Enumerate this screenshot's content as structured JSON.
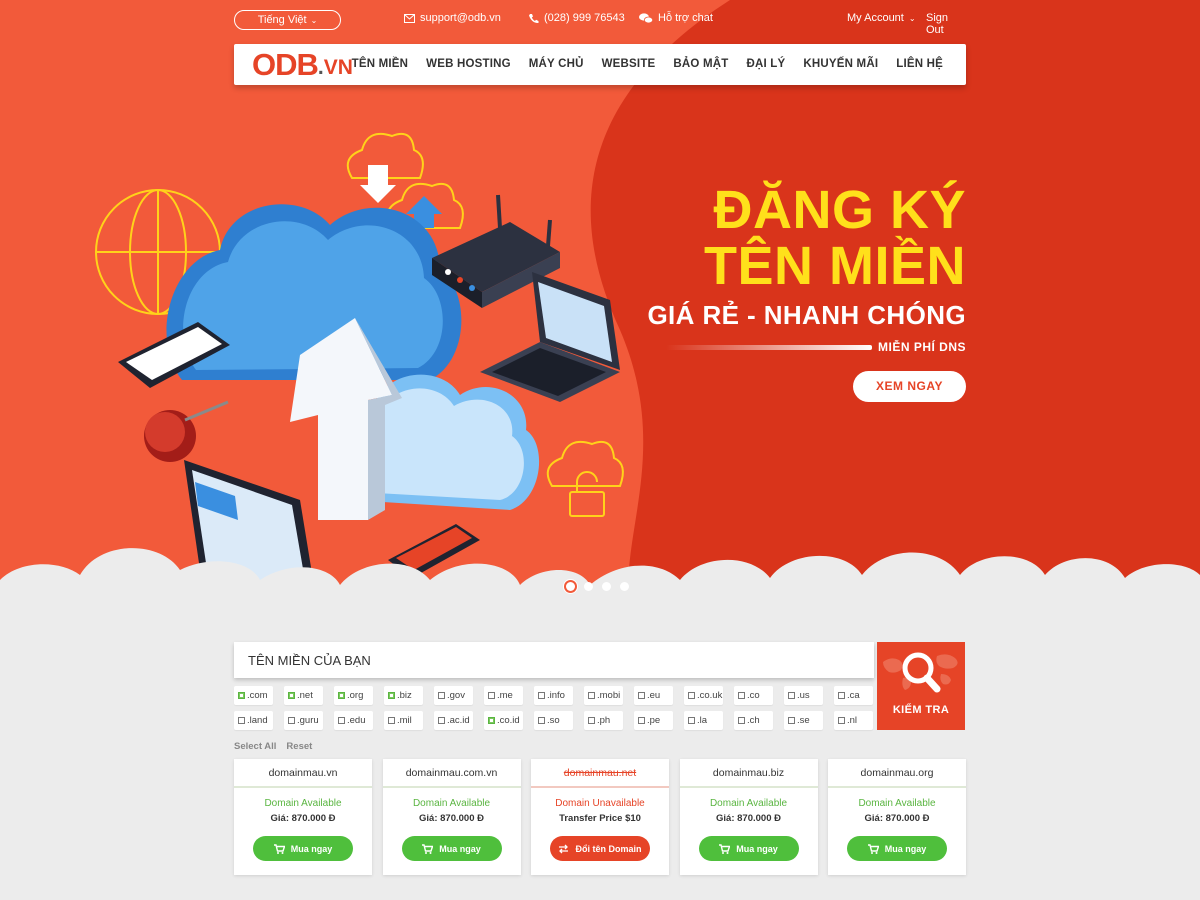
{
  "topbar": {
    "language": "Tiếng Việt",
    "email": "support@odb.vn",
    "phone": "(028) 999 76543",
    "chat": "Hỗ trợ chat",
    "account": "My Account",
    "signout": "Sign Out"
  },
  "logo": {
    "main": "ODB",
    "dot": ".",
    "suffix": "VN"
  },
  "nav": [
    "TÊN MIỀN",
    "WEB HOSTING",
    "MÁY CHỦ",
    "WEBSITE",
    "BẢO MẬT",
    "ĐẠI LÝ",
    "KHUYẾN MÃI",
    "LIÊN HỆ"
  ],
  "hero": {
    "line1": "ĐĂNG KÝ",
    "line2": "TÊN MIỀN",
    "subtitle": "GIÁ RẺ - NHANH CHÓNG",
    "tag": "MIỄN PHÍ DNS",
    "cta": "XEM NGAY",
    "slides": 4,
    "active_slide": 1
  },
  "search": {
    "placeholder": "TÊN MIỀN CỦA BẠN",
    "button": "KIỂM TRA",
    "select_all": "Select All",
    "reset": "Reset",
    "tlds": [
      {
        "name": ".com",
        "checked": true
      },
      {
        "name": ".net",
        "checked": true
      },
      {
        "name": ".org",
        "checked": true
      },
      {
        "name": ".biz",
        "checked": true
      },
      {
        "name": ".gov",
        "checked": false
      },
      {
        "name": ".me",
        "checked": false
      },
      {
        "name": ".info",
        "checked": false
      },
      {
        "name": ".mobi",
        "checked": false
      },
      {
        "name": ".eu",
        "checked": false
      },
      {
        "name": ".co.uk",
        "checked": false
      },
      {
        "name": ".co",
        "checked": false
      },
      {
        "name": ".us",
        "checked": false
      },
      {
        "name": ".ca",
        "checked": false
      },
      {
        "name": ".land",
        "checked": false
      },
      {
        "name": ".guru",
        "checked": false
      },
      {
        "name": ".edu",
        "checked": false
      },
      {
        "name": ".mil",
        "checked": false
      },
      {
        "name": ".ac.id",
        "checked": false
      },
      {
        "name": ".co.id",
        "checked": true
      },
      {
        "name": ".so",
        "checked": false
      },
      {
        "name": ".ph",
        "checked": false
      },
      {
        "name": ".pe",
        "checked": false
      },
      {
        "name": ".la",
        "checked": false
      },
      {
        "name": ".ch",
        "checked": false
      },
      {
        "name": ".se",
        "checked": false
      },
      {
        "name": ".nl",
        "checked": false
      }
    ]
  },
  "results": [
    {
      "domain": "domainmau.vn",
      "available": true,
      "status": "Domain Available",
      "price": "Giá: 870.000 Đ",
      "button": "Mua ngay"
    },
    {
      "domain": "domainmau.com.vn",
      "available": true,
      "status": "Domain Available",
      "price": "Giá: 870.000 Đ",
      "button": "Mua ngay"
    },
    {
      "domain": "domainmau.net",
      "available": false,
      "status": "Domain Unavailable",
      "price": "Transfer Price $10",
      "button": "Đổi tên Domain"
    },
    {
      "domain": "domainmau.biz",
      "available": true,
      "status": "Domain Available",
      "price": "Giá: 870.000 Đ",
      "button": "Mua ngay"
    },
    {
      "domain": "domainmau.org",
      "available": true,
      "status": "Domain Available",
      "price": "Giá: 870.000 Đ",
      "button": "Mua ngay"
    }
  ],
  "colors": {
    "brand": "#e64427",
    "hero_bg": "#f25a3a",
    "hero_dark": "#d9341b",
    "headline": "#ffe01b",
    "available": "#4fbf3c"
  }
}
